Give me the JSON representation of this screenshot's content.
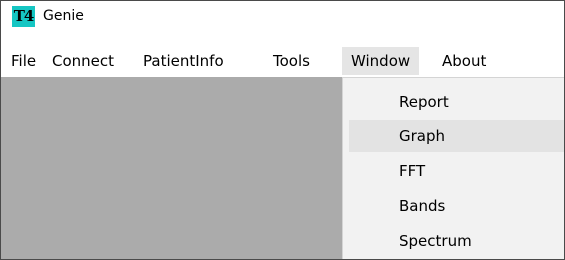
{
  "titlebar": {
    "icon_text": "T4",
    "title": "Genie",
    "icon_color": "#15c6c3"
  },
  "menubar": {
    "items": [
      {
        "label": "File"
      },
      {
        "label": "Connect"
      },
      {
        "label": "PatientInfo"
      },
      {
        "label": "Tools"
      },
      {
        "label": "Window",
        "open": true
      },
      {
        "label": "About"
      }
    ]
  },
  "window_menu": {
    "items": [
      {
        "label": "Report"
      },
      {
        "label": "Graph",
        "highlighted": true
      },
      {
        "label": "FFT"
      },
      {
        "label": "Bands"
      },
      {
        "label": "Spectrum"
      }
    ]
  },
  "colors": {
    "workspace": "#ababab",
    "menu_background": "#f2f2f2",
    "highlight": "#e3e3e3"
  }
}
